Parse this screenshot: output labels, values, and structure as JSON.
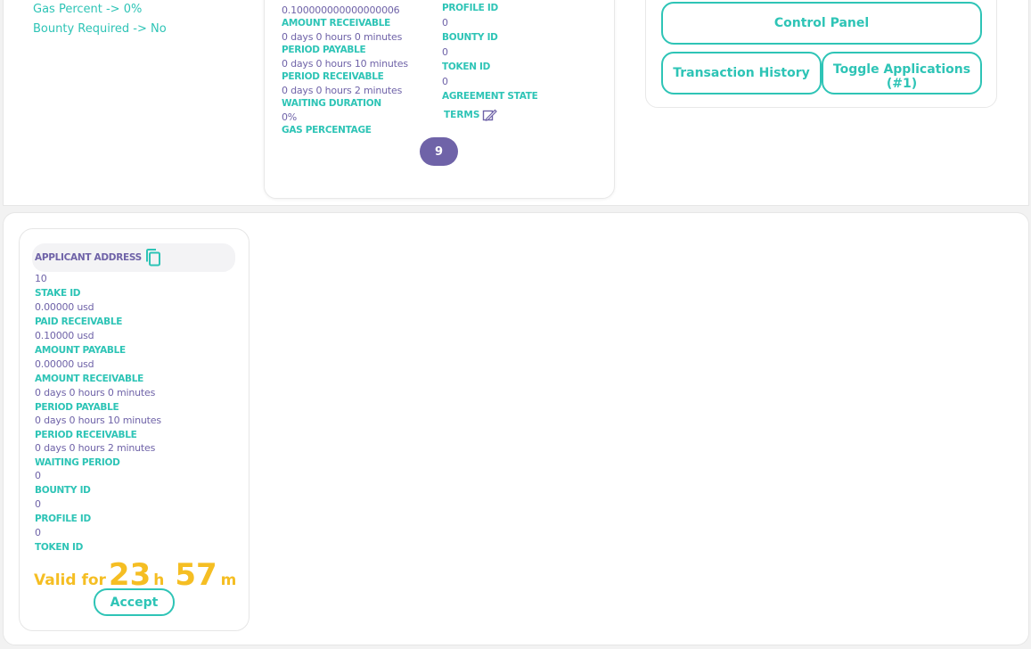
{
  "left_info": {
    "gas_percent": "Gas Percent -> 0%",
    "bounty_required": "Bounty Required -> No"
  },
  "agreement_card": {
    "col1": [
      {
        "value": "0.100000000000000006",
        "label": "AMOUNT RECEIVABLE"
      },
      {
        "value": "0 days 0 hours 0 minutes",
        "label": "PERIOD PAYABLE"
      },
      {
        "value": "0 days 0 hours 10 minutes",
        "label": "PERIOD RECEIVABLE"
      },
      {
        "value": "0 days 0 hours 2 minutes",
        "label": "WAITING DURATION"
      },
      {
        "value": "0%",
        "label": "GAS PERCENTAGE"
      }
    ],
    "col2_first_label": "PROFILE ID",
    "col2": [
      {
        "value": "0",
        "label": "BOUNTY ID"
      },
      {
        "value": "0",
        "label": "TOKEN ID"
      },
      {
        "value": "0",
        "label": "AGREEMENT STATE"
      }
    ],
    "terms_label": "TERMS",
    "page_number": "9"
  },
  "control": {
    "control_panel": "Control Panel",
    "transaction_history": "Transaction History",
    "toggle_applications": "Toggle Applications (#1)"
  },
  "applicant": {
    "address_label": "APPLICANT ADDRESS",
    "fields": [
      {
        "value": "10",
        "label": "STAKE ID"
      },
      {
        "value": "0.00000 usd",
        "label": "PAID RECEIVABLE"
      },
      {
        "value": "0.10000 usd",
        "label": "AMOUNT PAYABLE"
      },
      {
        "value": "0.00000 usd",
        "label": "AMOUNT RECEIVABLE"
      },
      {
        "value": "0 days 0 hours 0 minutes",
        "label": "PERIOD PAYABLE"
      },
      {
        "value": "0 days 0 hours 10 minutes",
        "label": "PERIOD RECEIVABLE"
      },
      {
        "value": "0 days 0 hours 2 minutes",
        "label": "WAITING PERIOD"
      },
      {
        "value": "0",
        "label": "BOUNTY ID"
      },
      {
        "value": "0",
        "label": "PROFILE ID"
      },
      {
        "value": "0",
        "label": "TOKEN ID"
      }
    ],
    "valid_prefix": "Valid for",
    "hours": "23",
    "hours_unit": "h",
    "minutes": "57",
    "minutes_unit": "m",
    "accept": "Accept"
  },
  "colors": {
    "teal": "#2ec4b6",
    "purple": "#6f63a8",
    "gold": "#f5be23"
  },
  "icons": {
    "copy": "copy-icon",
    "terms": "document-edit-icon"
  }
}
